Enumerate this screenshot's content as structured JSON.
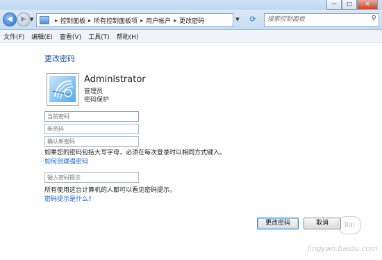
{
  "window": {
    "buttons": [
      "—",
      "□",
      "✕"
    ]
  },
  "nav": {
    "back_icon": "back-arrow-icon",
    "forward_icon": "forward-arrow-icon",
    "breadcrumbs": [
      "控制面板",
      "所有控制面板项",
      "用户帐户",
      "更改密码"
    ],
    "search_placeholder": "搜索控制面板"
  },
  "menu": [
    "文件(F)",
    "编辑(E)",
    "查看(V)",
    "工具(T)",
    "帮助(H)"
  ],
  "page": {
    "title": "更改密码",
    "user": {
      "name": "Administrator",
      "role": "管理员",
      "protection": "密码保护"
    },
    "fields": {
      "current_placeholder": "当前密码",
      "new_placeholder": "新密码",
      "confirm_placeholder": "确认新密码",
      "hint_placeholder": "键入密码提示"
    },
    "caps_warning": "如果您的密码包括大写字母，必须在每次登录时以相同方式键入。",
    "strong_link": "如何创建强密码",
    "hint_warning": "所有使用这台计算机的人都可以看见密码提示。",
    "hint_link": "密码提示是什么?",
    "buttons": {
      "change": "更改密码",
      "cancel": "取消"
    }
  },
  "watermark": "jingyan.baidu.com"
}
